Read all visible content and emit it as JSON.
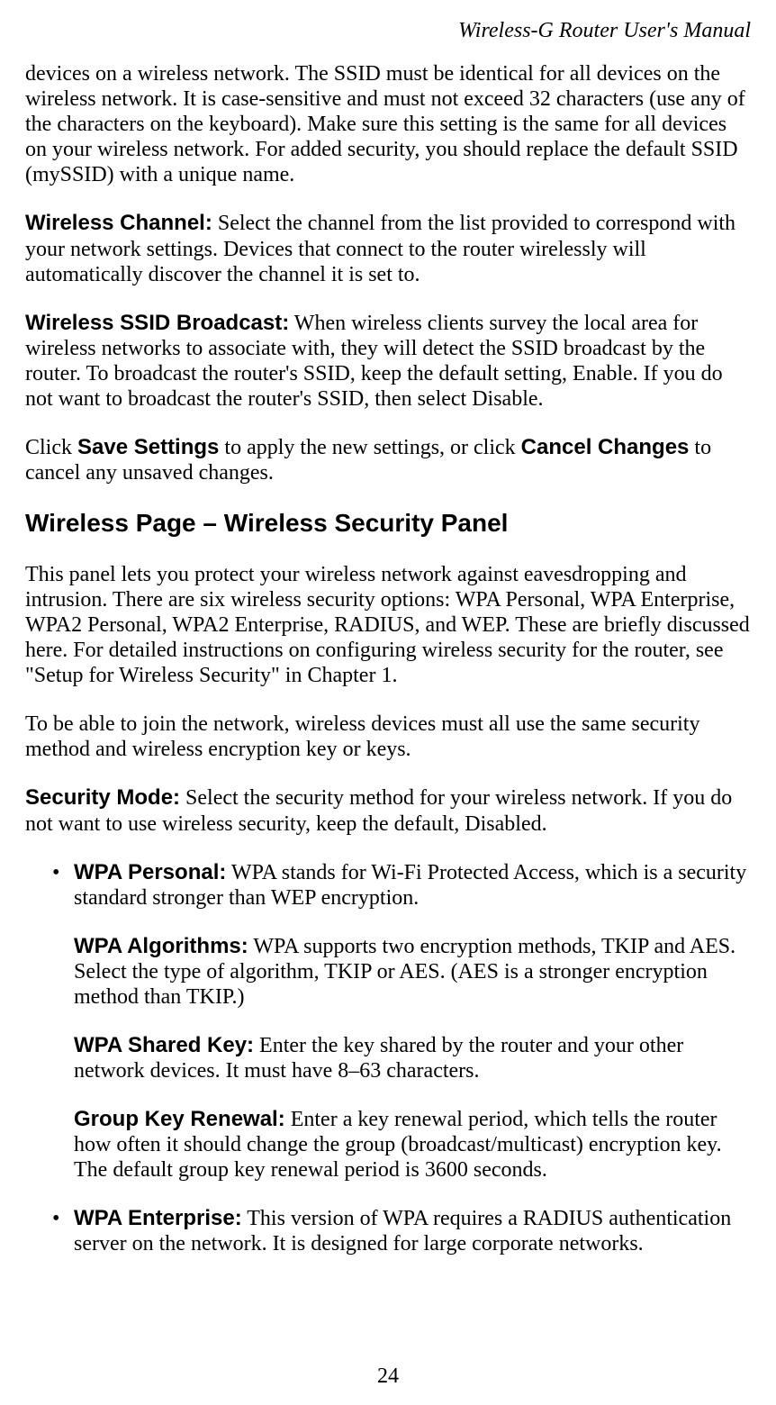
{
  "runningHead": "Wireless-G Router User's Manual",
  "pageNumber": "24",
  "sectionHeading": "Wireless Page – Wireless Security Panel",
  "paras": {
    "ssidIntro": "devices on a wireless network. The SSID must be identical for all devices on the wireless network. It is case-sensitive and must not exceed 32 characters (use any of the characters on the keyboard). Make sure this setting is the same for all devices on your wireless network. For added security, you should replace the default SSID (mySSID) with a unique name.",
    "wirelessChannel": {
      "label": "Wireless Channel:",
      "text": " Select the channel from the list provided to correspond with your network settings. Devices that connect to the router wirelessly will automatically discover the channel it is set to."
    },
    "ssidBroadcast": {
      "label": "Wireless SSID Broadcast:",
      "text": " When wireless clients survey the local area for wireless networks to associate with, they will detect the SSID broadcast by the router. To broadcast the router's SSID, keep the default setting, Enable. If you do not want to broadcast the router's SSID, then select Disable."
    },
    "saveCancel": {
      "t1": "Click ",
      "b1": "Save Settings",
      "t2": " to apply the new settings, or click ",
      "b2": "Cancel Changes",
      "t3": " to cancel any unsaved changes."
    },
    "securityIntro": "This panel lets you protect your wireless network against eavesdropping and intrusion. There are six wireless security options: WPA Personal, WPA Enterprise, WPA2 Personal, WPA2 Enterprise, RADIUS, and WEP. These are briefly discussed here. For detailed instructions on configuring wireless security for the router, see \"Setup for Wireless Security\" in Chapter 1.",
    "joinNote": "To be able to join the network, wireless devices must all use the same security method and wireless encryption key or keys.",
    "securityMode": {
      "label": "Security Mode:",
      "text": " Select the security method for your wireless network. If you do not want to use wireless security, keep the default, Disabled."
    },
    "wpaPersonal": {
      "label": "WPA Personal:",
      "text": " WPA stands for Wi-Fi Protected Access, which is a security standard stronger than WEP encryption."
    },
    "wpaAlgorithms": {
      "label": "WPA Algorithms:",
      "text": " WPA supports two encryption methods, TKIP and AES. Select the type of algorithm, TKIP or AES. (AES is a stronger encryption method than TKIP.)"
    },
    "wpaSharedKey": {
      "label": "WPA Shared Key:",
      "text": " Enter the key shared by the router and your other network devices. It must have 8–63 characters."
    },
    "groupKeyRenewal": {
      "label": "Group Key Renewal:",
      "text": " Enter a key renewal period, which tells the router how often it should change the group (broadcast/multicast) encryption key. The default group key renewal period is 3600 seconds."
    },
    "wpaEnterprise": {
      "label": "WPA Enterprise:",
      "text": " This version of WPA requires a RADIUS authentication server on the network. It is designed for large corporate networks."
    }
  }
}
